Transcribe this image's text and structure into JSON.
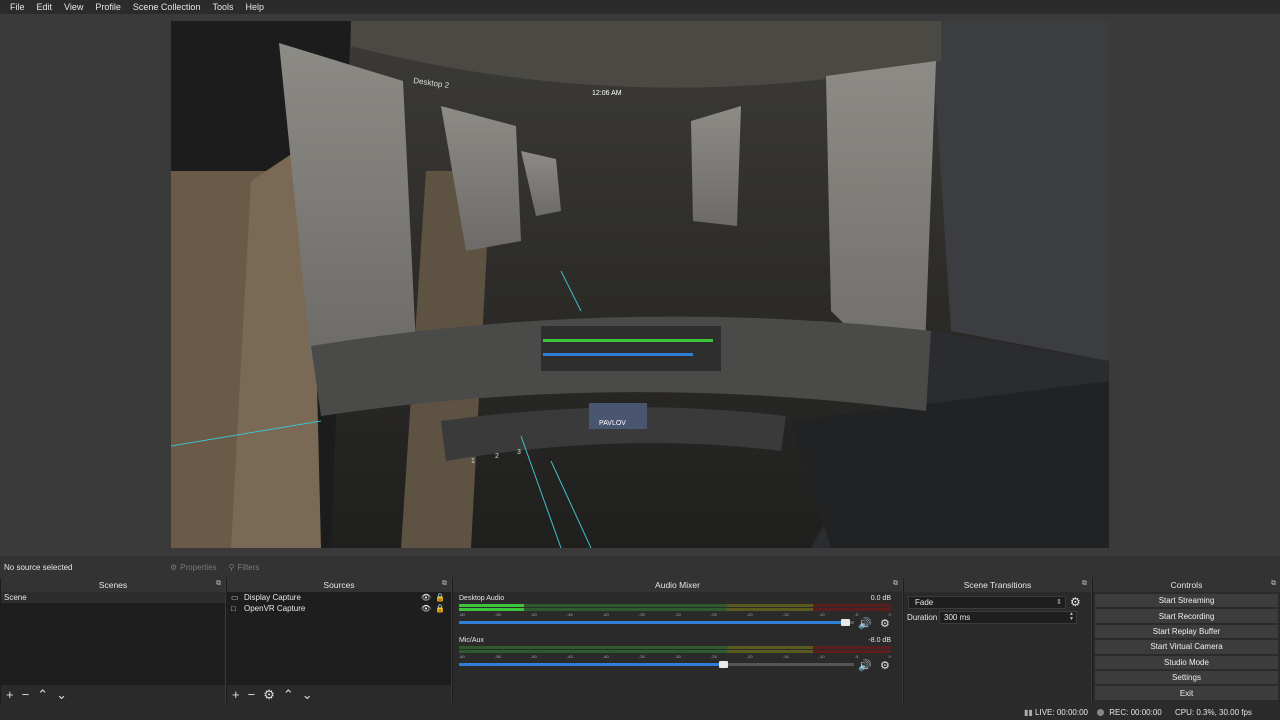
{
  "menu": [
    "File",
    "Edit",
    "View",
    "Profile",
    "Scene Collection",
    "Tools",
    "Help"
  ],
  "preview": {
    "overlay_text": {
      "desktop": "Desktop 2",
      "clock": "12:06 AM",
      "game": "PAVLOV",
      "pager": [
        "1",
        "2",
        "3"
      ]
    }
  },
  "property_bar": {
    "no_source": "No source selected",
    "properties": "Properties",
    "filters": "Filters"
  },
  "scenes": {
    "title": "Scenes",
    "items": [
      "Scene"
    ]
  },
  "sources": {
    "title": "Sources",
    "items": [
      {
        "name": "Display Capture",
        "icon": "monitor-icon"
      },
      {
        "name": "OpenVR Capture",
        "icon": "window-icon"
      }
    ]
  },
  "mixer": {
    "title": "Audio Mixer",
    "channels": [
      {
        "name": "Desktop Audio",
        "db": "0.0 dB",
        "level": 0.15,
        "volume": 0.98
      },
      {
        "name": "Mic/Aux",
        "db": "-8.0 dB",
        "level": 0.0,
        "volume": 0.67
      }
    ],
    "ticks": [
      "-60",
      "-55",
      "-50",
      "-45",
      "-40",
      "-35",
      "-30",
      "-25",
      "-20",
      "-15",
      "-10",
      "-5",
      "0"
    ]
  },
  "transitions": {
    "title": "Scene Transitions",
    "selected": "Fade",
    "duration_label": "Duration",
    "duration_value": "300 ms"
  },
  "controls": {
    "title": "Controls",
    "buttons": [
      "Start Streaming",
      "Start Recording",
      "Start Replay Buffer",
      "Start Virtual Camera",
      "Studio Mode",
      "Settings",
      "Exit"
    ]
  },
  "status": {
    "live": "LIVE: 00:00:00",
    "rec": "REC: 00:00:00",
    "cpu": "CPU: 0.3%, 30.00 fps"
  },
  "colors": {
    "accent": "#2f7fd6",
    "meter_green": "#3cc43c"
  }
}
